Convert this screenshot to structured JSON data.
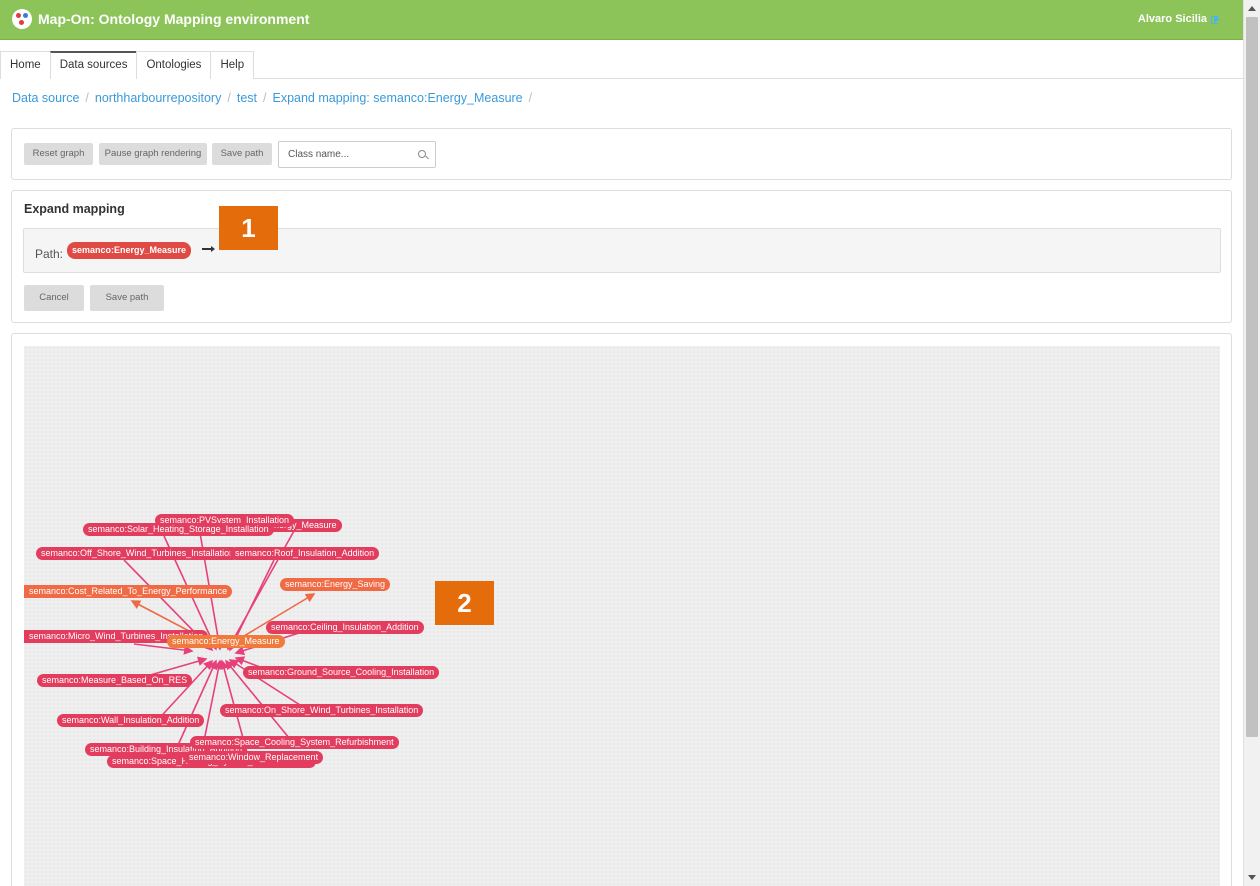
{
  "header": {
    "title": "Map-On: Ontology Mapping environment",
    "user": "Alvaro Sicilia"
  },
  "tabs": [
    "Home",
    "Data sources",
    "Ontologies",
    "Help"
  ],
  "active_tab": "Data sources",
  "breadcrumb": [
    "Data source",
    "northharbourrepository",
    "test",
    "Expand mapping: semanco:Energy_Measure"
  ],
  "toolbar": {
    "reset_label": "Reset graph",
    "pause_label": "Pause graph rendering",
    "save_path_label": "Save path",
    "search_placeholder": "Class name..."
  },
  "expand": {
    "title": "Expand mapping",
    "path_label": "Path:",
    "path_item": "semanco:Energy_Measure",
    "cancel_label": "Cancel",
    "save_label": "Save path"
  },
  "graph": {
    "center": "semanco:Energy_Measure",
    "nodes": [
      "semanco:PVSystem_Installation",
      "semanco:Solar_Heating_Storage_Installation",
      "semanco:Wall_Insulation_Addition",
      "semanco:Off_Shore_Wind_Turbines_Installation",
      "semanco:Roof_Insulation_Addition",
      "semanco:Cost_Related_To_Energy_Performance",
      "semanco:Energy_Saving",
      "semanco:Ceiling_Insulation_Addition",
      "semanco:Micro_Wind_Turbines_Installation",
      "semanco:Ground_Source_Cooling_Installation",
      "semanco:Measure_Based_On_RES",
      "semanco:On_Shore_Wind_Turbines_Installation",
      "semanco:Wall_Insulation_Addition",
      "semanco:Space_Cooling_System_Refurbishment",
      "semanco:Building_Insulation_Addition",
      "semanco:Window_Replacement",
      "semanco:Space_Heating_System_Refurbishment"
    ]
  },
  "annotations": [
    "1",
    "2"
  ],
  "colors": {
    "header": "#8cc45a",
    "link": "#3a9ad9",
    "node": "#e23c5e",
    "node_out": "#f06a45",
    "annotation": "#e46c0a"
  }
}
